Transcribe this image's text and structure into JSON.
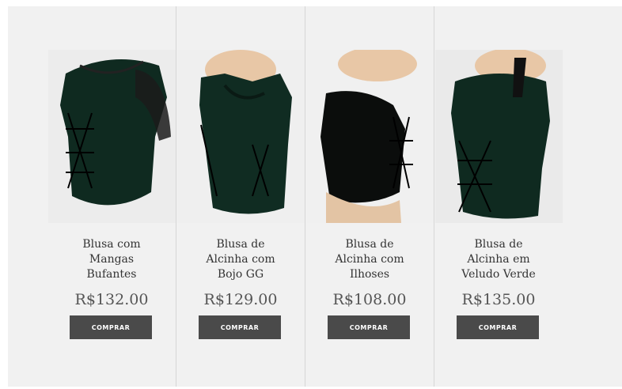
{
  "products": [
    {
      "title_lines": [
        "Blusa com",
        "Mangas",
        "Bufantes"
      ],
      "price": "R$132.00",
      "button": "COMPRAR",
      "image": "green velvet corset top with puffed sleeves"
    },
    {
      "title_lines": [
        "Blusa de",
        "Alcinha com",
        "Bojo GG"
      ],
      "price": "R$129.00",
      "button": "COMPRAR",
      "image": "green velvet corset top with thin straps"
    },
    {
      "title_lines": [
        "Blusa de",
        "Alcinha com",
        "Ilhoses"
      ],
      "price": "R$108.00",
      "button": "COMPRAR",
      "image": "black velvet corset camisole with side lacing"
    },
    {
      "title_lines": [
        "Blusa de",
        "Alcinha em",
        "Veludo Verde"
      ],
      "price": "R$135.00",
      "button": "COMPRAR",
      "image": "green velvet corset top with front lacing"
    }
  ],
  "colors": {
    "background": "#f1f1f1",
    "button": "#4a4a4a",
    "velvet_green": "#0f2a20",
    "velvet_black": "#0b0d0c"
  }
}
